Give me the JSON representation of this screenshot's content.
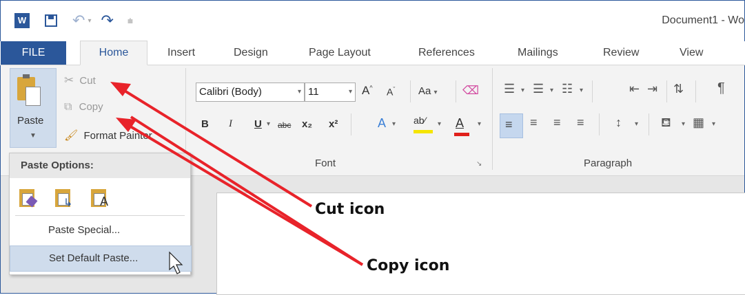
{
  "window": {
    "title": "Document1 - Wo"
  },
  "qat": {
    "word_icon": "word-logo-icon",
    "save_icon": "save-icon",
    "undo_icon": "undo-icon",
    "redo_icon": "redo-icon",
    "customize_icon": "customize-icon"
  },
  "tabs": [
    {
      "label": "FILE"
    },
    {
      "label": "Home"
    },
    {
      "label": "Insert"
    },
    {
      "label": "Design"
    },
    {
      "label": "Page Layout"
    },
    {
      "label": "References"
    },
    {
      "label": "Mailings"
    },
    {
      "label": "Review"
    },
    {
      "label": "View"
    }
  ],
  "clipboard": {
    "paste_label": "Paste",
    "cut_label": "Cut",
    "copy_label": "Copy",
    "format_painter_label": "Format Painter"
  },
  "font": {
    "font_name": "Calibri (Body)",
    "font_size": "11",
    "change_case": "Aa",
    "group_label": "Font",
    "bold": "B",
    "italic": "I",
    "underline": "U",
    "strike": "abc",
    "subscript": "x₂",
    "superscript": "x²",
    "highlight_color": "#f5e500",
    "font_color": "#e0201b"
  },
  "paragraph": {
    "group_label": "Paragraph"
  },
  "paste_menu": {
    "header": "Paste Options:",
    "paste_special": "Paste Special...",
    "set_default": "Set Default Paste..."
  },
  "annotations": {
    "cut": "Cut icon",
    "copy": "Copy icon",
    "arrow_color": "#e8232a"
  }
}
